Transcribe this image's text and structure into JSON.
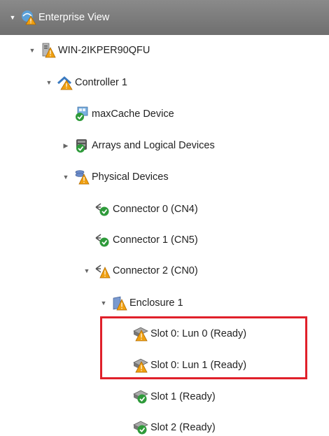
{
  "tree": {
    "root": {
      "label": "Enterprise View",
      "icon": "enterprise-warning-icon"
    },
    "server": {
      "label": "WIN-2IKPER90QFU",
      "icon": "server-warning-icon"
    },
    "controller": {
      "label": "Controller 1",
      "icon": "controller-warning-icon"
    },
    "maxcache": {
      "label": "maxCache Device",
      "icon": "maxcache-ok-icon"
    },
    "arrays": {
      "label": "Arrays and Logical Devices",
      "icon": "arrays-ok-icon"
    },
    "physical": {
      "label": "Physical Devices",
      "icon": "physical-warning-icon"
    },
    "connector0": {
      "label": "Connector 0 (CN4)",
      "icon": "connector-ok-icon"
    },
    "connector1": {
      "label": "Connector 1 (CN5)",
      "icon": "connector-ok-icon"
    },
    "connector2": {
      "label": "Connector 2 (CN0)",
      "icon": "connector-warning-icon"
    },
    "enclosure": {
      "label": "Enclosure 1",
      "icon": "enclosure-warning-icon"
    },
    "slot0lun0": {
      "label": "Slot 0: Lun 0 (Ready)",
      "icon": "disk-warning-icon"
    },
    "slot0lun1": {
      "label": "Slot 0: Lun 1 (Ready)",
      "icon": "disk-warning-icon"
    },
    "slot1": {
      "label": "Slot 1 (Ready)",
      "icon": "disk-ok-icon"
    },
    "slot2": {
      "label": "Slot 2 (Ready)",
      "icon": "disk-ok-icon"
    }
  },
  "colors": {
    "header_bg": "#7a7a7a",
    "highlight": "#e0202a",
    "warning": "#f0a010",
    "ok": "#2e9a3a"
  }
}
